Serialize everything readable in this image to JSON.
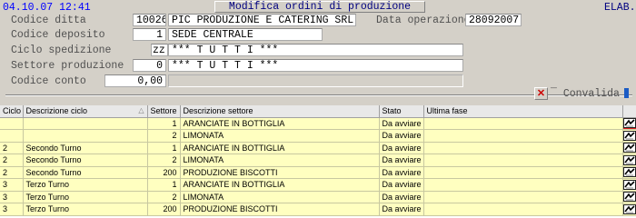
{
  "header": {
    "datetime": "04.10.07 12:41",
    "title": "Modifica ordini di produzione",
    "elab": "ELAB."
  },
  "form": {
    "codice_ditta": {
      "label": "Codice  ditta",
      "code": "10026",
      "name": "PIC PRODUZIONE E CATERING SRL"
    },
    "data_operazione": {
      "label": "Data operazione",
      "value": "28092007"
    },
    "codice_deposito": {
      "label": "Codice  deposito",
      "code": "1",
      "name": "SEDE CENTRALE"
    },
    "ciclo_spedizione": {
      "label": "Ciclo    spedizione",
      "code": "zz",
      "name": "*** T U T T I ***"
    },
    "settore_produzione": {
      "label": "Settore produzione",
      "code": "0",
      "name": "*** T U T T I ***"
    },
    "codice_conto": {
      "label": "Codice  conto",
      "code": "",
      "value": "0,00"
    }
  },
  "actions": {
    "cancel_icon": "x-icon",
    "convalida_label": "Convalida"
  },
  "grid": {
    "columns": [
      "Ciclo",
      "Descrizione ciclo",
      "Settore",
      "Descrizione settore",
      "Stato",
      "Ultima fase",
      ""
    ],
    "rows": [
      {
        "ciclo": "",
        "descr_ciclo": "",
        "settore": "1",
        "descr_settore": "ARANCIATE IN BOTTIGLIA",
        "stato": "Da avviare",
        "ultima_fase": ""
      },
      {
        "ciclo": "",
        "descr_ciclo": "",
        "settore": "2",
        "descr_settore": "LIMONATA",
        "stato": "Da avviare",
        "ultima_fase": ""
      },
      {
        "ciclo": "2",
        "descr_ciclo": "Secondo Turno",
        "settore": "1",
        "descr_settore": "ARANCIATE IN BOTTIGLIA",
        "stato": "Da avviare",
        "ultima_fase": ""
      },
      {
        "ciclo": "2",
        "descr_ciclo": "Secondo Turno",
        "settore": "2",
        "descr_settore": "LIMONATA",
        "stato": "Da avviare",
        "ultima_fase": ""
      },
      {
        "ciclo": "2",
        "descr_ciclo": "Secondo Turno",
        "settore": "200",
        "descr_settore": "PRODUZIONE BISCOTTI",
        "stato": "Da avviare",
        "ultima_fase": ""
      },
      {
        "ciclo": "3",
        "descr_ciclo": "Terzo Turno",
        "settore": "1",
        "descr_settore": "ARANCIATE IN BOTTIGLIA",
        "stato": "Da avviare",
        "ultima_fase": ""
      },
      {
        "ciclo": "3",
        "descr_ciclo": "Terzo Turno",
        "settore": "2",
        "descr_settore": "LIMONATA",
        "stato": "Da avviare",
        "ultima_fase": ""
      },
      {
        "ciclo": "3",
        "descr_ciclo": "Terzo Turno",
        "settore": "200",
        "descr_settore": "PRODUZIONE BISCOTTI",
        "stato": "Da avviare",
        "ultima_fase": ""
      }
    ],
    "row_icon": "edit-detail-icon"
  },
  "colors": {
    "row_bg": "#ffffc0",
    "title_text": "#000080",
    "datetime_text": "#0000ff",
    "selected_outline": "#e02020"
  }
}
